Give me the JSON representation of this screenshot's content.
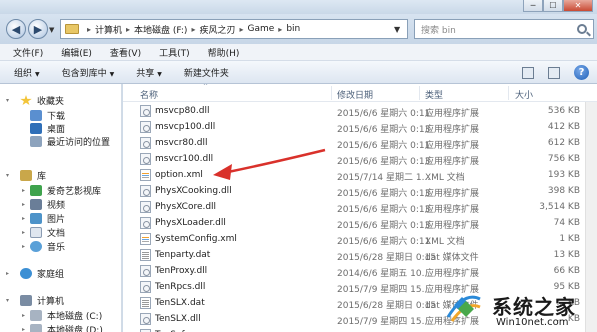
{
  "window": {
    "minimize": "─",
    "maximize": "☐",
    "close": "✕"
  },
  "nav": {
    "back": "◀",
    "forward": "▶",
    "dropdown": "▼"
  },
  "address": {
    "crumbs": [
      "计算机",
      "本地磁盘 (F:)",
      "疾风之刃",
      "Game",
      "bin"
    ],
    "separator": "▸",
    "dropdown": "▼",
    "refresh": "⟳"
  },
  "search": {
    "placeholder": "搜索 bin"
  },
  "menu": [
    "文件(F)",
    "编辑(E)",
    "查看(V)",
    "工具(T)",
    "帮助(H)"
  ],
  "toolbar": {
    "organize": "组织",
    "include_library": "包含到库中",
    "share": "共享",
    "new_folder": "新建文件夹",
    "caret": "▼",
    "help": "?"
  },
  "sidebar": {
    "favorites": {
      "label": "收藏夹",
      "items": [
        "下载",
        "桌面",
        "最近访问的位置"
      ]
    },
    "libraries": {
      "label": "库",
      "items": [
        "爱奇艺影视库",
        "视频",
        "图片",
        "文档",
        "音乐"
      ]
    },
    "homegroup": "家庭组",
    "computer": {
      "label": "计算机",
      "items": [
        "本地磁盘 (C:)",
        "本地磁盘 (D:)"
      ]
    }
  },
  "columns": {
    "name": "名称",
    "date": "修改日期",
    "type": "类型",
    "size": "大小",
    "sort": "^"
  },
  "files": [
    {
      "name": "msvcp80.dll",
      "date": "2015/6/6 星期六 0:11",
      "type": "应用程序扩展",
      "size": "536 KB",
      "icon": "dll"
    },
    {
      "name": "msvcp100.dll",
      "date": "2015/6/6 星期六 0:13",
      "type": "应用程序扩展",
      "size": "412 KB",
      "icon": "dll"
    },
    {
      "name": "msvcr80.dll",
      "date": "2015/6/6 星期六 0:11",
      "type": "应用程序扩展",
      "size": "612 KB",
      "icon": "dll"
    },
    {
      "name": "msvcr100.dll",
      "date": "2015/6/6 星期六 0:13",
      "type": "应用程序扩展",
      "size": "756 KB",
      "icon": "dll"
    },
    {
      "name": "option.xml",
      "date": "2015/7/14 星期二 1...",
      "type": "XML 文档",
      "size": "193 KB",
      "icon": "xml"
    },
    {
      "name": "PhysXCooking.dll",
      "date": "2015/6/6 星期六 0:13",
      "type": "应用程序扩展",
      "size": "398 KB",
      "icon": "dll"
    },
    {
      "name": "PhysXCore.dll",
      "date": "2015/6/6 星期六 0:13",
      "type": "应用程序扩展",
      "size": "3,514 KB",
      "icon": "dll"
    },
    {
      "name": "PhysXLoader.dll",
      "date": "2015/6/6 星期六 0:13",
      "type": "应用程序扩展",
      "size": "74 KB",
      "icon": "dll"
    },
    {
      "name": "SystemConfig.xml",
      "date": "2015/6/6 星期六 0:11",
      "type": "XML 文档",
      "size": "1 KB",
      "icon": "xml"
    },
    {
      "name": "Tenparty.dat",
      "date": "2015/6/28 星期日 0:15",
      "type": "dat 媒体文件",
      "size": "13 KB",
      "icon": "dat"
    },
    {
      "name": "TenProxy.dll",
      "date": "2014/6/6 星期五 10...",
      "type": "应用程序扩展",
      "size": "66 KB",
      "icon": "dll"
    },
    {
      "name": "TenRpcs.dll",
      "date": "2015/7/9 星期四 15...",
      "type": "应用程序扩展",
      "size": "95 KB",
      "icon": "dll"
    },
    {
      "name": "TenSLX.dat",
      "date": "2015/6/28 星期日 0:15",
      "type": "dat 媒体文件",
      "size": "... KB",
      "icon": "dat"
    },
    {
      "name": "TenSLX.dll",
      "date": "2015/7/9 星期四 15...",
      "type": "应用程序扩展",
      "size": "... KB",
      "icon": "dll"
    },
    {
      "name": "TenSafe...",
      "date": "2015/6/... 星期...",
      "type": "应用程序扩展",
      "size": "",
      "icon": "dll"
    }
  ],
  "watermark": {
    "title": "系统之家",
    "url": "Win10net.com"
  },
  "colors": {
    "accent_arrow": "#d9312b",
    "folder": "#e8c766",
    "header_text": "#4c607a"
  }
}
